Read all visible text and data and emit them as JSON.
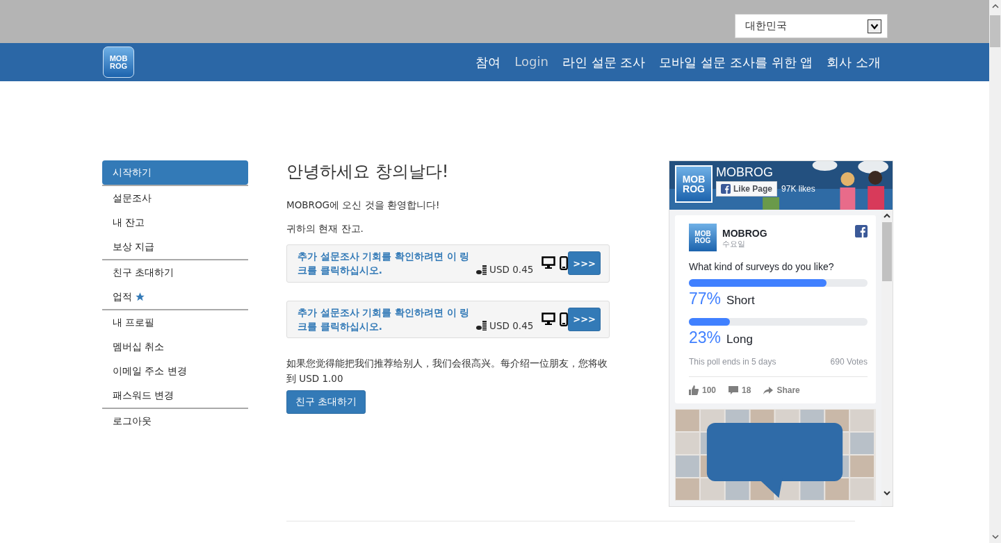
{
  "country_select": {
    "value": "대한민국"
  },
  "logo": {
    "lines": [
      "MOB",
      "ROG"
    ]
  },
  "page_logo": {
    "lines": [
      "MOB",
      "ROG"
    ]
  },
  "avatar_logo": {
    "lines": [
      "MOB",
      "ROG"
    ]
  },
  "nav": [
    {
      "label": "참여",
      "selected": false
    },
    {
      "label": "Login",
      "selected": true
    },
    {
      "label": "라인 설문 조사",
      "selected": false
    },
    {
      "label": "모바일 설문 조사를 위한 앱",
      "selected": false
    },
    {
      "label": "회사 소개",
      "selected": false
    }
  ],
  "sidebar": {
    "groups": [
      {
        "items": [
          {
            "label": "시작하기",
            "selected": true,
            "starred": false
          }
        ]
      },
      {
        "items": [
          {
            "label": "설문조사",
            "selected": false,
            "starred": false
          },
          {
            "label": "내 잔고",
            "selected": false,
            "starred": false
          },
          {
            "label": "보상 지급",
            "selected": false,
            "starred": false
          }
        ]
      },
      {
        "items": [
          {
            "label": "친구 초대하기",
            "selected": false,
            "starred": false
          },
          {
            "label": "업적",
            "selected": false,
            "starred": true
          }
        ]
      },
      {
        "items": [
          {
            "label": "내 프로필",
            "selected": false,
            "starred": false
          },
          {
            "label": "멤버십 취소",
            "selected": false,
            "starred": false
          },
          {
            "label": "이메일 주소 변경",
            "selected": false,
            "starred": false
          },
          {
            "label": "패스워드 변경",
            "selected": false,
            "starred": false
          }
        ]
      },
      {
        "items": [
          {
            "label": "로그아웃",
            "selected": false,
            "starred": false
          }
        ]
      }
    ]
  },
  "main": {
    "title": "안녕하세요 창의날다!",
    "welcome": "MOBROG에 오신 것을 환영합니다!",
    "balance": "귀하의 현재 잔고.",
    "surveys": [
      {
        "link": "추가 설문조사 기회를 확인하려면 이 링크를 클릭하십시오.",
        "reward": "USD 0.45",
        "button": ">>>"
      },
      {
        "link": "추가 설문조사 기회를 확인하려면 이 링크를 클릭하십시오.",
        "reward": "USD 0.45",
        "button": ">>>"
      }
    ],
    "referral": "如果您觉得能把我们推荐给别人，我们会很高兴。每介绍一位朋友，您将收到 USD 1.00",
    "invite_button": "친구 초대하기"
  },
  "facebook": {
    "page_name": "MOBROG",
    "like_button": "Like Page",
    "likes": "97K likes",
    "post": {
      "author": "MOBROG",
      "date": "수요일",
      "question": "What kind of surveys do you like?",
      "options": [
        {
          "percent": "77%",
          "label": "Short",
          "level": 0.77
        },
        {
          "percent": "23%",
          "label": "Long",
          "level": 0.23
        }
      ],
      "ends": "This poll ends in 5 days",
      "votes": "690 Votes",
      "likes": "100",
      "comments": "18",
      "share": "Share"
    }
  }
}
